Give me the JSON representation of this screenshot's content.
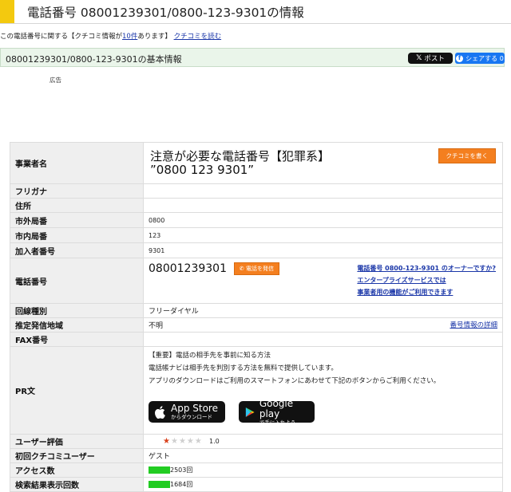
{
  "header": {
    "title": "電話番号 08001239301/0800-123-9301の情報"
  },
  "notice": {
    "prefix": "この電話番号に関する【クチコミ情報が",
    "count_link": "10件",
    "suffix": "あります】",
    "read_link": "クチコミを読む"
  },
  "section": {
    "title": "08001239301/0800-123-9301の基本情報",
    "post_label": "ポスト",
    "share_label": "シェアする 0"
  },
  "ad_label": "広告",
  "table": {
    "business": {
      "label": "事業者名",
      "name_line1": "注意が必要な電話番号【犯罪系】",
      "name_line2": "”0800 123 9301”",
      "button": "クチコミを書く"
    },
    "furigana": {
      "label": "フリガナ",
      "value": ""
    },
    "address": {
      "label": "住所",
      "value": ""
    },
    "area_code": {
      "label": "市外局番",
      "value": "0800"
    },
    "local_code": {
      "label": "市内局番",
      "value": "123"
    },
    "subscriber": {
      "label": "加入者番号",
      "value": "9301"
    },
    "phone": {
      "label": "電話番号",
      "value": "08001239301",
      "call_button": "電話を発信",
      "owner_line1": "電話番号 0800-123-9301 のオーナーですか?",
      "owner_line2": "エンタープライズサービスでは",
      "owner_line3": "事業者用の機能がご利用できます"
    },
    "line_type": {
      "label": "回線種別",
      "value": "フリーダイヤル"
    },
    "location": {
      "label": "推定発信地域",
      "value": "不明",
      "link": "番号情報の詳細"
    },
    "fax": {
      "label": "FAX番号",
      "value": ""
    },
    "pr": {
      "label": "PR文",
      "line1": "【重要】電話の相手先を事前に知る方法",
      "line2": "電話帳ナビは相手先を判別する方法を無料で提供しています。",
      "line3": "アプリのダウンロードはご利用のスマートフォンにあわせて下記のボタンからご利用ください。",
      "appstore_big": "App Store",
      "appstore_small": "からダウンロード",
      "google_big": "Google play",
      "google_small": "で手に入れよう"
    },
    "rating": {
      "label": "ユーザー評価",
      "value": "1.0",
      "stars": 1,
      "max": 5
    },
    "first_user": {
      "label": "初回クチコミユーザー",
      "value": "ゲスト"
    },
    "access": {
      "label": "アクセス数",
      "value": "2503回"
    },
    "search": {
      "label": "検索結果表示回数",
      "value": "1684回"
    }
  },
  "colors": {
    "accent": "#f3c90f",
    "orange": "#f47f1f",
    "link": "#1a36a8",
    "bar": "#22cc22"
  },
  "icons": [
    "x-logo-icon",
    "facebook-icon",
    "phone-icon",
    "apple-icon",
    "google-play-icon",
    "star-icon"
  ]
}
